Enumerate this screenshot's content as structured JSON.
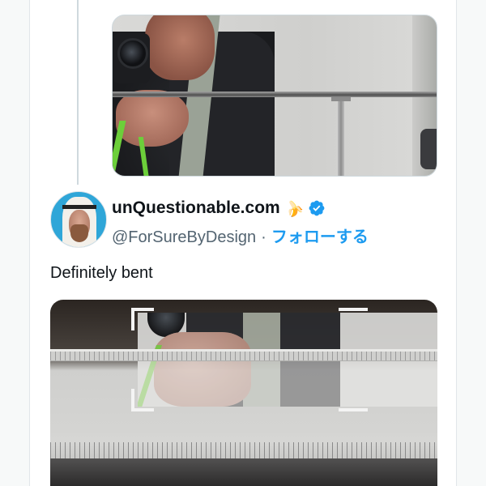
{
  "tweet": {
    "display_name": "unQuestionable.com",
    "name_emoji": "🍌",
    "handle": "@ForSureByDesign",
    "separator": "·",
    "follow_label": "フォローする",
    "text": "Definitely bent"
  },
  "icons": {
    "verified": "verified-badge-icon",
    "emoji": "banana-icon"
  },
  "colors": {
    "accent": "#1d9bf0",
    "text_primary": "#0f1419",
    "text_secondary": "#536471",
    "lanyard": "#6ccf3a"
  }
}
